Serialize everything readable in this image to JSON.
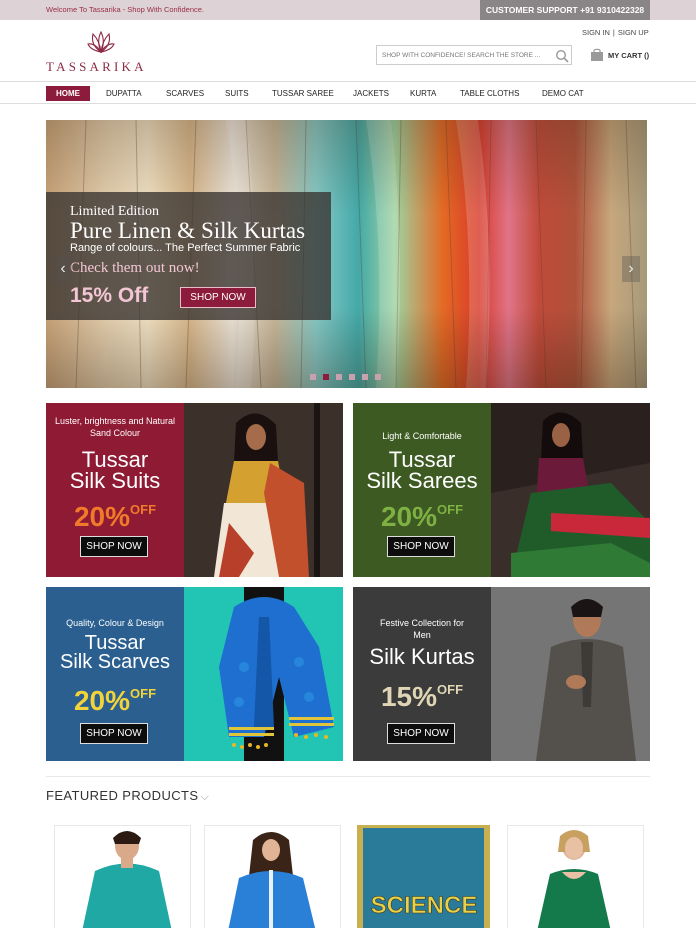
{
  "topbar": {
    "welcome": "Welcome To Tassarika - Shop With Confidence.",
    "support": "CUSTOMER SUPPORT +91 9310422328"
  },
  "header": {
    "logo_text": "TASSARIKA",
    "sign_in": "SIGN IN",
    "separator": "|",
    "sign_up": "SIGN UP",
    "search_placeholder": "SHOP WITH CONFIDENCE! SEARCH THE STORE ...",
    "cart_label": "MY CART",
    "cart_count": "()"
  },
  "nav": {
    "items": [
      "HOME",
      "DUPATTA",
      "SCARVES",
      "SUITS",
      "TUSSAR SAREE",
      "JACKETS",
      "KURTA",
      "TABLE CLOTHS",
      "DEMO CAT"
    ],
    "active": "HOME"
  },
  "hero": {
    "line1": "Limited Edition",
    "line2": "Pure Linen & Silk Kurtas",
    "line3": "Range of colours... The Perfect Summer Fabric",
    "line4": "Check them out now!",
    "offer": "15% Off",
    "button": "SHOP NOW",
    "prev_arrow": "‹",
    "next_arrow": "›",
    "slide_count": 6,
    "active_slide": 2
  },
  "promos": [
    {
      "small": "Luster, brightness and Natural Sand Colour",
      "big1": "Tussar",
      "big2": "Silk Suits",
      "pct": "20%",
      "off": "OFF",
      "button": "SHOP NOW",
      "bg": "#8f1a34",
      "pct_color": "#f07a2a"
    },
    {
      "small": "Light & Comfortable",
      "big1": "Tussar",
      "big2": "Silk Sarees",
      "pct": "20%",
      "off": "OFF",
      "button": "SHOP NOW",
      "bg": "#3d5a22",
      "pct_color": "#7fb043"
    },
    {
      "small": "Quality, Colour & Design",
      "big1": "Tussar",
      "big2": "Silk Scarves",
      "pct": "20%",
      "off": "OFF",
      "button": "SHOP NOW",
      "bg": "#2a5f8f",
      "pct_color": "#f2d43a"
    },
    {
      "small": "Festive Collection for Men",
      "big1": "",
      "big2": "Silk Kurtas",
      "pct": "15%",
      "off": "OFF",
      "button": "SHOP NOW",
      "bg": "#3b3b3b",
      "pct_color": "#e0d6b5"
    }
  ],
  "featured": {
    "title": "FEATURED PRODUCTS",
    "chevron": "⌵",
    "science_text": "SCIENCE"
  },
  "colors": {
    "brand": "#8d1c3c",
    "topbar_bg": "#ddd3d6",
    "support_bg": "#8a8586"
  }
}
